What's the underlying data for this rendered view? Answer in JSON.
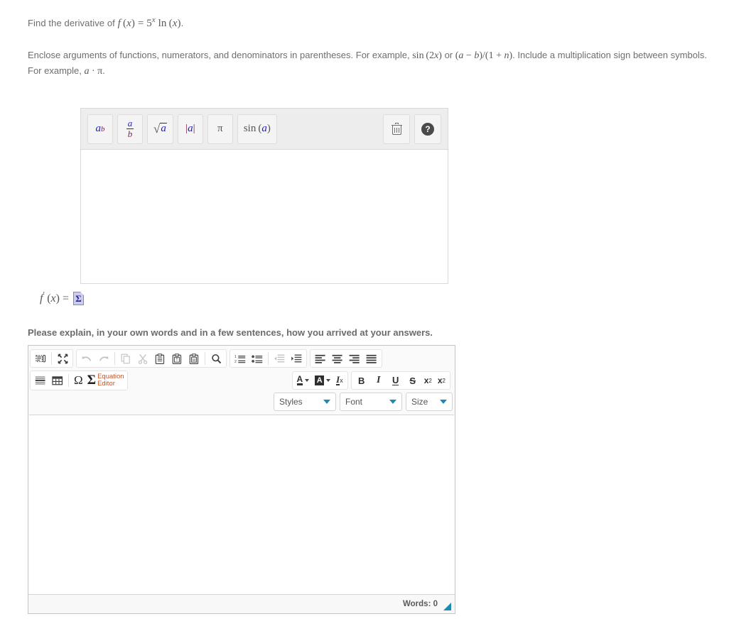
{
  "question": {
    "prefix": "Find the derivative of ",
    "function_label": "f (x) = 5^x ln (x).",
    "f_name": "f",
    "var": "x",
    "base": "5",
    "exponent": "x",
    "ln": "ln",
    "suffix": "."
  },
  "instructions": {
    "part1": "Enclose arguments of functions, numerators, and denominators in parentheses. For example, ",
    "example1": "sin (2x)",
    "conjunction": " or ",
    "example2": "(a − b)/(1 + n)",
    "part2": ". Include a multiplication sign between symbols. For example, ",
    "example3": "a · π",
    "part3": "."
  },
  "math_editor": {
    "buttons": [
      {
        "name": "power-button",
        "label": "a^b",
        "base": "a",
        "exp": "b"
      },
      {
        "name": "fraction-button",
        "label": "a/b",
        "num": "a",
        "den": "b"
      },
      {
        "name": "square-root-button",
        "label": "√a",
        "radicand": "a"
      },
      {
        "name": "absolute-value-button",
        "label": "|a|",
        "inner": "a"
      },
      {
        "name": "pi-button",
        "label": "π"
      },
      {
        "name": "sine-button",
        "label": "sin (a)",
        "fn": "sin",
        "arg": "a"
      }
    ],
    "clear_button": {
      "name": "clear-button",
      "icon": "trash-icon",
      "tooltip": "Clear"
    },
    "help_button": {
      "name": "help-button",
      "icon": "help-icon",
      "glyph": "?",
      "tooltip": "Help"
    },
    "input_value": "",
    "input_placeholder": ""
  },
  "answer": {
    "label_plain": "f' (x) =",
    "f": "f",
    "prime": "′",
    "var": "x",
    "equals": "=",
    "equation_icon": "sigma-page-icon",
    "sigma": "Σ"
  },
  "explain": {
    "prompt": "Please explain, in your own words and in a few sentences, how you arrived at your answers."
  },
  "rte": {
    "row1": {
      "group_doc": [
        {
          "name": "templates-button",
          "icon": "templates-icon",
          "label": "Templates",
          "disabled": false
        },
        {
          "name": "maximize-button",
          "icon": "maximize-icon",
          "label": "Maximize",
          "disabled": false
        }
      ],
      "group_clipboard": [
        {
          "name": "undo-button",
          "icon": "undo-icon",
          "label": "Undo",
          "disabled": true
        },
        {
          "name": "redo-button",
          "icon": "redo-icon",
          "label": "Redo",
          "disabled": true
        },
        {
          "name": "copy-button",
          "icon": "copy-icon",
          "label": "Copy",
          "disabled": true
        },
        {
          "name": "cut-button",
          "icon": "cut-icon",
          "label": "Cut",
          "disabled": true
        },
        {
          "name": "paste-button",
          "icon": "paste-icon",
          "label": "Paste",
          "disabled": false
        },
        {
          "name": "paste-text-button",
          "icon": "paste-text-icon",
          "label": "Paste as plain text",
          "disabled": false
        },
        {
          "name": "paste-word-button",
          "icon": "paste-word-icon",
          "label": "Paste from Word",
          "disabled": false
        },
        {
          "name": "find-button",
          "icon": "search-icon",
          "label": "Find",
          "disabled": false
        }
      ],
      "group_lists": [
        {
          "name": "numbered-list-button",
          "icon": "numbered-list-icon",
          "label": "Insert/Remove Numbered List",
          "disabled": false
        },
        {
          "name": "bulleted-list-button",
          "icon": "bulleted-list-icon",
          "label": "Insert/Remove Bulleted List",
          "disabled": false
        },
        {
          "name": "decrease-indent-button",
          "icon": "decrease-indent-icon",
          "label": "Decrease Indent",
          "disabled": true
        },
        {
          "name": "increase-indent-button",
          "icon": "increase-indent-icon",
          "label": "Increase Indent",
          "disabled": false
        }
      ],
      "group_align": [
        {
          "name": "align-left-button",
          "icon": "align-left-icon",
          "label": "Align Left",
          "disabled": false
        },
        {
          "name": "align-center-button",
          "icon": "align-center-icon",
          "label": "Center",
          "disabled": false
        },
        {
          "name": "align-right-button",
          "icon": "align-right-icon",
          "label": "Align Right",
          "disabled": false
        },
        {
          "name": "justify-button",
          "icon": "justify-icon",
          "label": "Justify",
          "disabled": false
        }
      ]
    },
    "row2": {
      "group_insert": [
        {
          "name": "horizontal-rule-button",
          "icon": "horizontal-rule-icon",
          "label": "Insert Horizontal Line",
          "disabled": false
        },
        {
          "name": "table-button",
          "icon": "table-icon",
          "label": "Table",
          "disabled": false
        },
        {
          "name": "special-char-button",
          "icon": "omega-icon",
          "glyph": "Ω",
          "label": "Insert Special Character",
          "disabled": false
        }
      ],
      "equation_editor": {
        "name": "equation-editor-button",
        "sigma": "Σ",
        "line1": "Equation",
        "line2": "Editor",
        "color": "#c0562a"
      },
      "group_color": [
        {
          "name": "text-color-button",
          "icon": "text-color-icon",
          "glyph": "A",
          "label": "Text Color"
        },
        {
          "name": "background-color-button",
          "icon": "background-color-icon",
          "glyph": "A",
          "label": "Background Color"
        },
        {
          "name": "remove-format-button",
          "icon": "remove-format-icon",
          "glyph": "I",
          "sub": "x",
          "label": "Remove Format"
        }
      ],
      "group_basic": [
        {
          "name": "bold-button",
          "glyph": "B",
          "label": "Bold"
        },
        {
          "name": "italic-button",
          "glyph": "I",
          "label": "Italic"
        },
        {
          "name": "underline-button",
          "glyph": "U",
          "label": "Underline"
        },
        {
          "name": "strikethrough-button",
          "glyph": "S",
          "label": "Strikethrough"
        },
        {
          "name": "subscript-button",
          "glyph": "x",
          "aff": "2",
          "label": "Subscript"
        },
        {
          "name": "superscript-button",
          "glyph": "x",
          "aff": "2",
          "label": "Superscript"
        }
      ]
    },
    "selects": [
      {
        "name": "styles-select",
        "label": "Styles"
      },
      {
        "name": "font-select",
        "label": "Font"
      },
      {
        "name": "size-select",
        "label": "Size"
      }
    ],
    "body_value": "",
    "status": {
      "words_label": "Words: 0",
      "resize_handle": "resize-grip"
    }
  },
  "colors": {
    "accent": "#1b8bb3",
    "equation_orange": "#c0562a",
    "math_blue": "#2222bb",
    "math_purple": "#772255",
    "text": "#6e6e6e",
    "toolbar_bg": "#ededed",
    "border": "#d9d9d9"
  }
}
